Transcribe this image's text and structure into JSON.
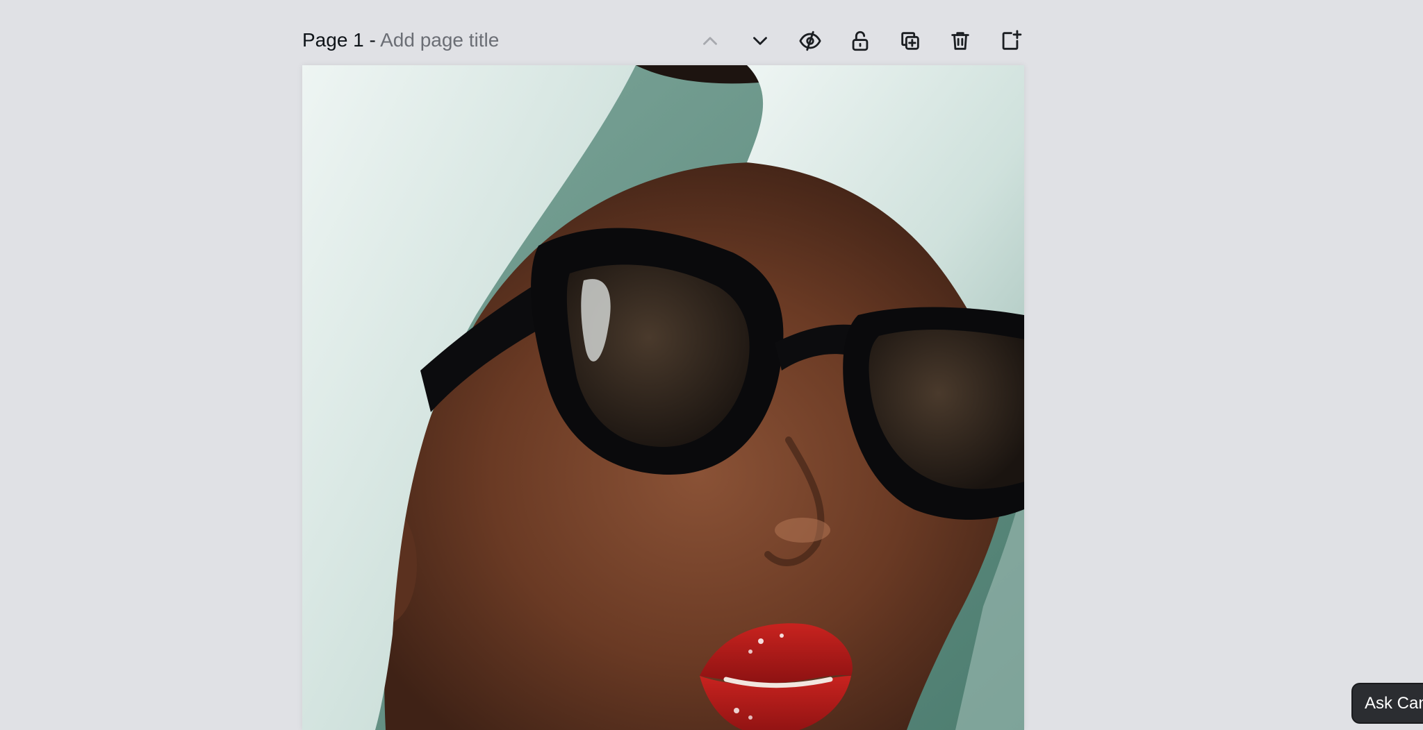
{
  "page_header": {
    "page_label": "Page 1 - ",
    "title_placeholder": "Add page title"
  },
  "toolbar": {
    "buttons": [
      {
        "name": "move-page-up",
        "icon": "chevron-up-icon",
        "enabled": false
      },
      {
        "name": "move-page-down",
        "icon": "chevron-down-icon",
        "enabled": true
      },
      {
        "name": "hide-page",
        "icon": "eye-slash-icon",
        "enabled": true
      },
      {
        "name": "lock-page",
        "icon": "unlock-icon",
        "enabled": true
      },
      {
        "name": "duplicate-page",
        "icon": "duplicate-icon",
        "enabled": true
      },
      {
        "name": "delete-page",
        "icon": "trash-icon",
        "enabled": true
      },
      {
        "name": "add-page",
        "icon": "add-page-icon",
        "enabled": true
      }
    ]
  },
  "canvas": {
    "image_subject": "portrait-woman-towel-sunglasses"
  },
  "assistant": {
    "label": "Ask Canva"
  },
  "colors": {
    "background": "#e0e1e5",
    "text": "#0e1318",
    "placeholder": "#6b6e75",
    "ask_button_bg": "#2b2d31"
  }
}
